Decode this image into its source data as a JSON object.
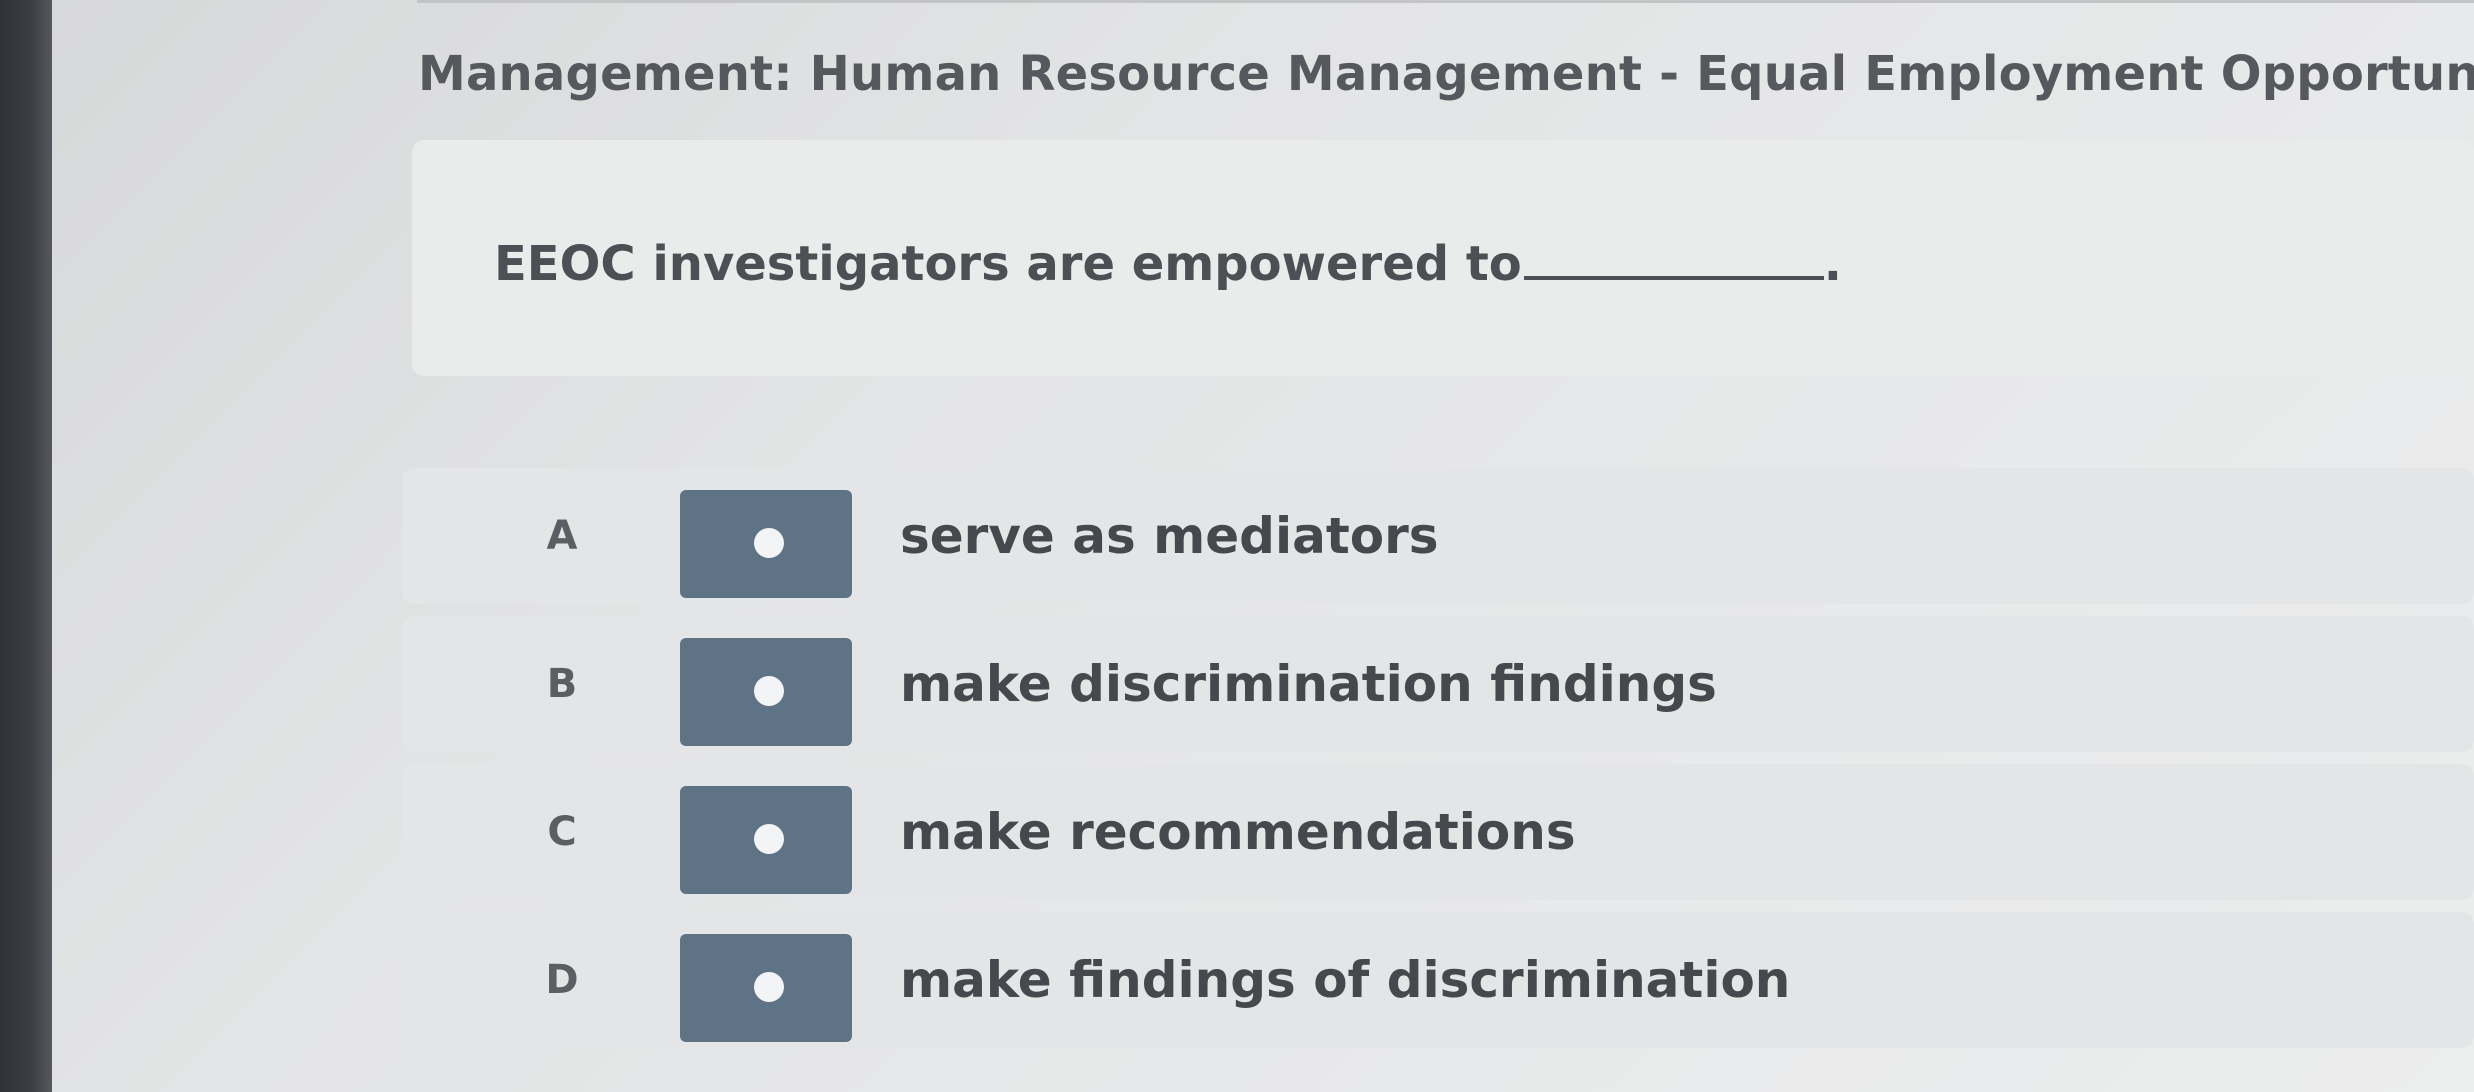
{
  "header": {
    "title": "Management: Human Resource Management - Equal Employment Opportunity"
  },
  "question": {
    "text": "EEOC investigators are empowered to",
    "trailing": "."
  },
  "options": [
    {
      "letter": "A",
      "text": "serve as mediators"
    },
    {
      "letter": "B",
      "text": "make discrimination findings"
    },
    {
      "letter": "C",
      "text": "make recommendations"
    },
    {
      "letter": "D",
      "text": "make findings of discrimination"
    }
  ],
  "colors": {
    "button": "#5f7387",
    "dot": "#f3f4f5",
    "text": "#45494d"
  },
  "icons": {
    "radio": "radio-dot-icon"
  }
}
